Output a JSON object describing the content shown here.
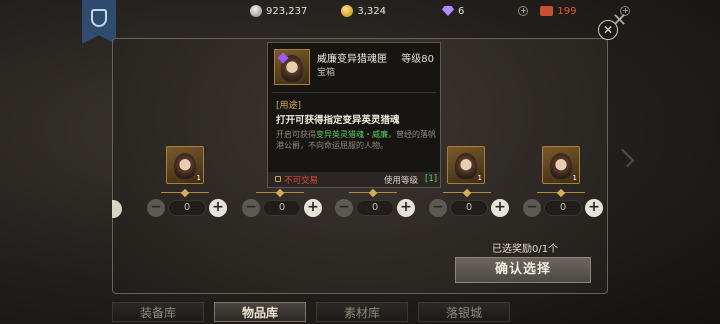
{
  "currency": {
    "silver": "923,237",
    "gold": "3,324",
    "gem": "6",
    "ticket": "199"
  },
  "close_label": "✕",
  "rewards": [
    {
      "count": "1",
      "value": "0"
    },
    {
      "count": "1",
      "value": "0"
    },
    {
      "count": "",
      "value": "0"
    },
    {
      "count": "1",
      "value": "0"
    },
    {
      "count": "1",
      "value": "0"
    }
  ],
  "selected_text": "已选奖励0/1个",
  "confirm_label": "确认选择",
  "tabs": [
    {
      "label": "装备库",
      "active": false
    },
    {
      "label": "物品库",
      "active": true
    },
    {
      "label": "素材库",
      "active": false
    },
    {
      "label": "落银城",
      "active": false
    }
  ],
  "tooltip": {
    "name": "威廉变异猎魂匣",
    "level": "等级80",
    "type": "宝箱",
    "usage_tag": "[用途]",
    "usage": "打开可获得指定变异英灵猎魂",
    "desc_prefix": "开启可获得",
    "desc_highlight": "变异英灵猎魂・威廉",
    "desc_suffix": "，曾经的落帆港公爵，不向命运屈服的人物。",
    "trade": "不可交易",
    "use_level_label": "使用等级",
    "use_level_value": "[1]"
  },
  "colors": {
    "accent_gold": "#a57f3a",
    "highlight_green": "#59d05a",
    "warning_red": "#e04a3c"
  }
}
